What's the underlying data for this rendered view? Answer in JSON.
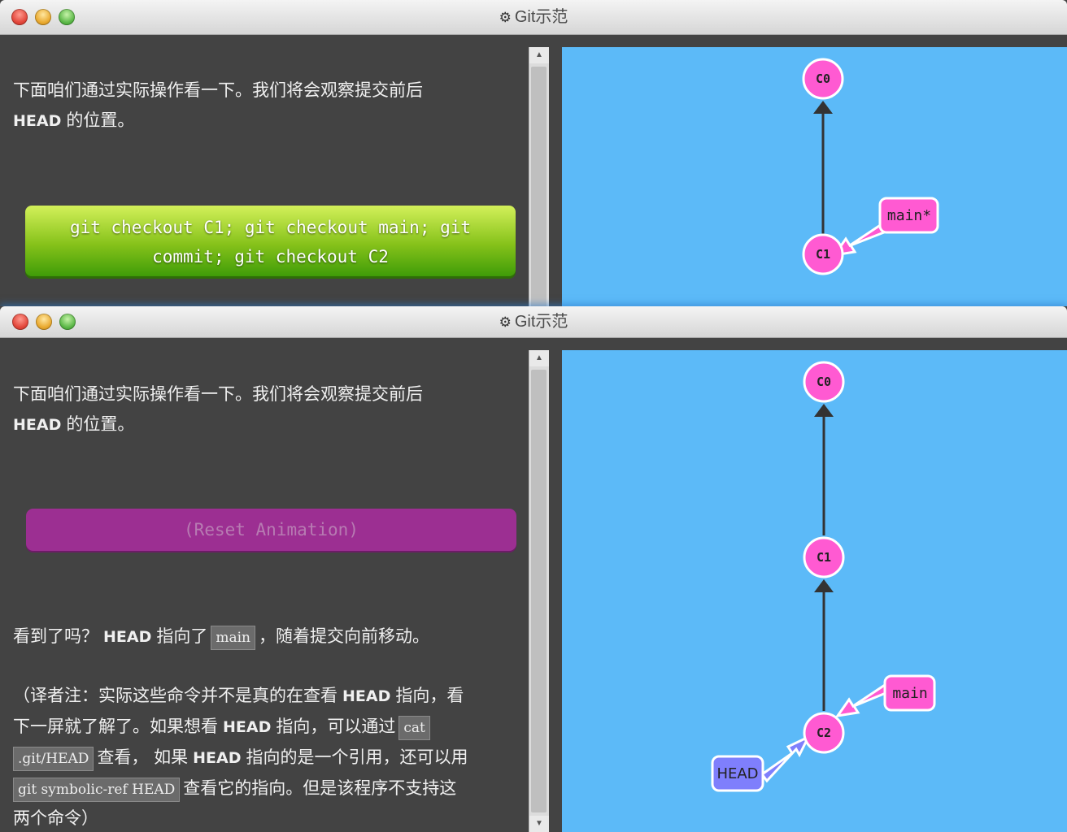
{
  "window_top": {
    "title": "Git示范",
    "intro_line1": "下面咱们通过实际操作看一下。我们将会观察提交前后",
    "intro_head": "HEAD",
    "intro_line2_rest": "的位置。",
    "command_line1": "git checkout C1; git checkout main; git",
    "command_line2": "commit; git checkout C2",
    "graph": {
      "commits": [
        "C0",
        "C1"
      ],
      "branch_label": "main*"
    }
  },
  "window_bottom": {
    "title": "Git示范",
    "intro_line1": "下面咱们通过实际操作看一下。我们将会观察提交前后",
    "intro_head": "HEAD",
    "intro_line2_rest": "的位置。",
    "reset_label": "(Reset Animation)",
    "para1": {
      "before": "看到了吗？",
      "head": "HEAD",
      "middle": "指向了",
      "code": "main",
      "after": "，随着提交向前移动。"
    },
    "para2": {
      "s1": "（译者注：实际这些命令并不是真的在查看",
      "head1": "HEAD",
      "s2": "指向，看",
      "s3": "下一屏就了解了。如果想看",
      "head2": "HEAD",
      "s4": "指向，可以通过",
      "code1a": "cat",
      "code1b": ".git/HEAD",
      "s5": "查看，",
      "s6": "如果",
      "head3": "HEAD",
      "s7": "指向的是一个引用，还可以用",
      "code2": "git symbolic-ref HEAD",
      "s8": "查看它的指向。但是该程序不支持这",
      "s9": "两个命令）"
    },
    "graph": {
      "commits": [
        "C0",
        "C1",
        "C2"
      ],
      "branch_label": "main",
      "head_label": "HEAD"
    }
  },
  "colors": {
    "commit_fill": "#ff5ad2",
    "branch_fill": "#ff5ad2",
    "head_fill": "#7f7ffc",
    "canvas_bg": "#5cbaf8",
    "panel_bg": "#434343"
  }
}
